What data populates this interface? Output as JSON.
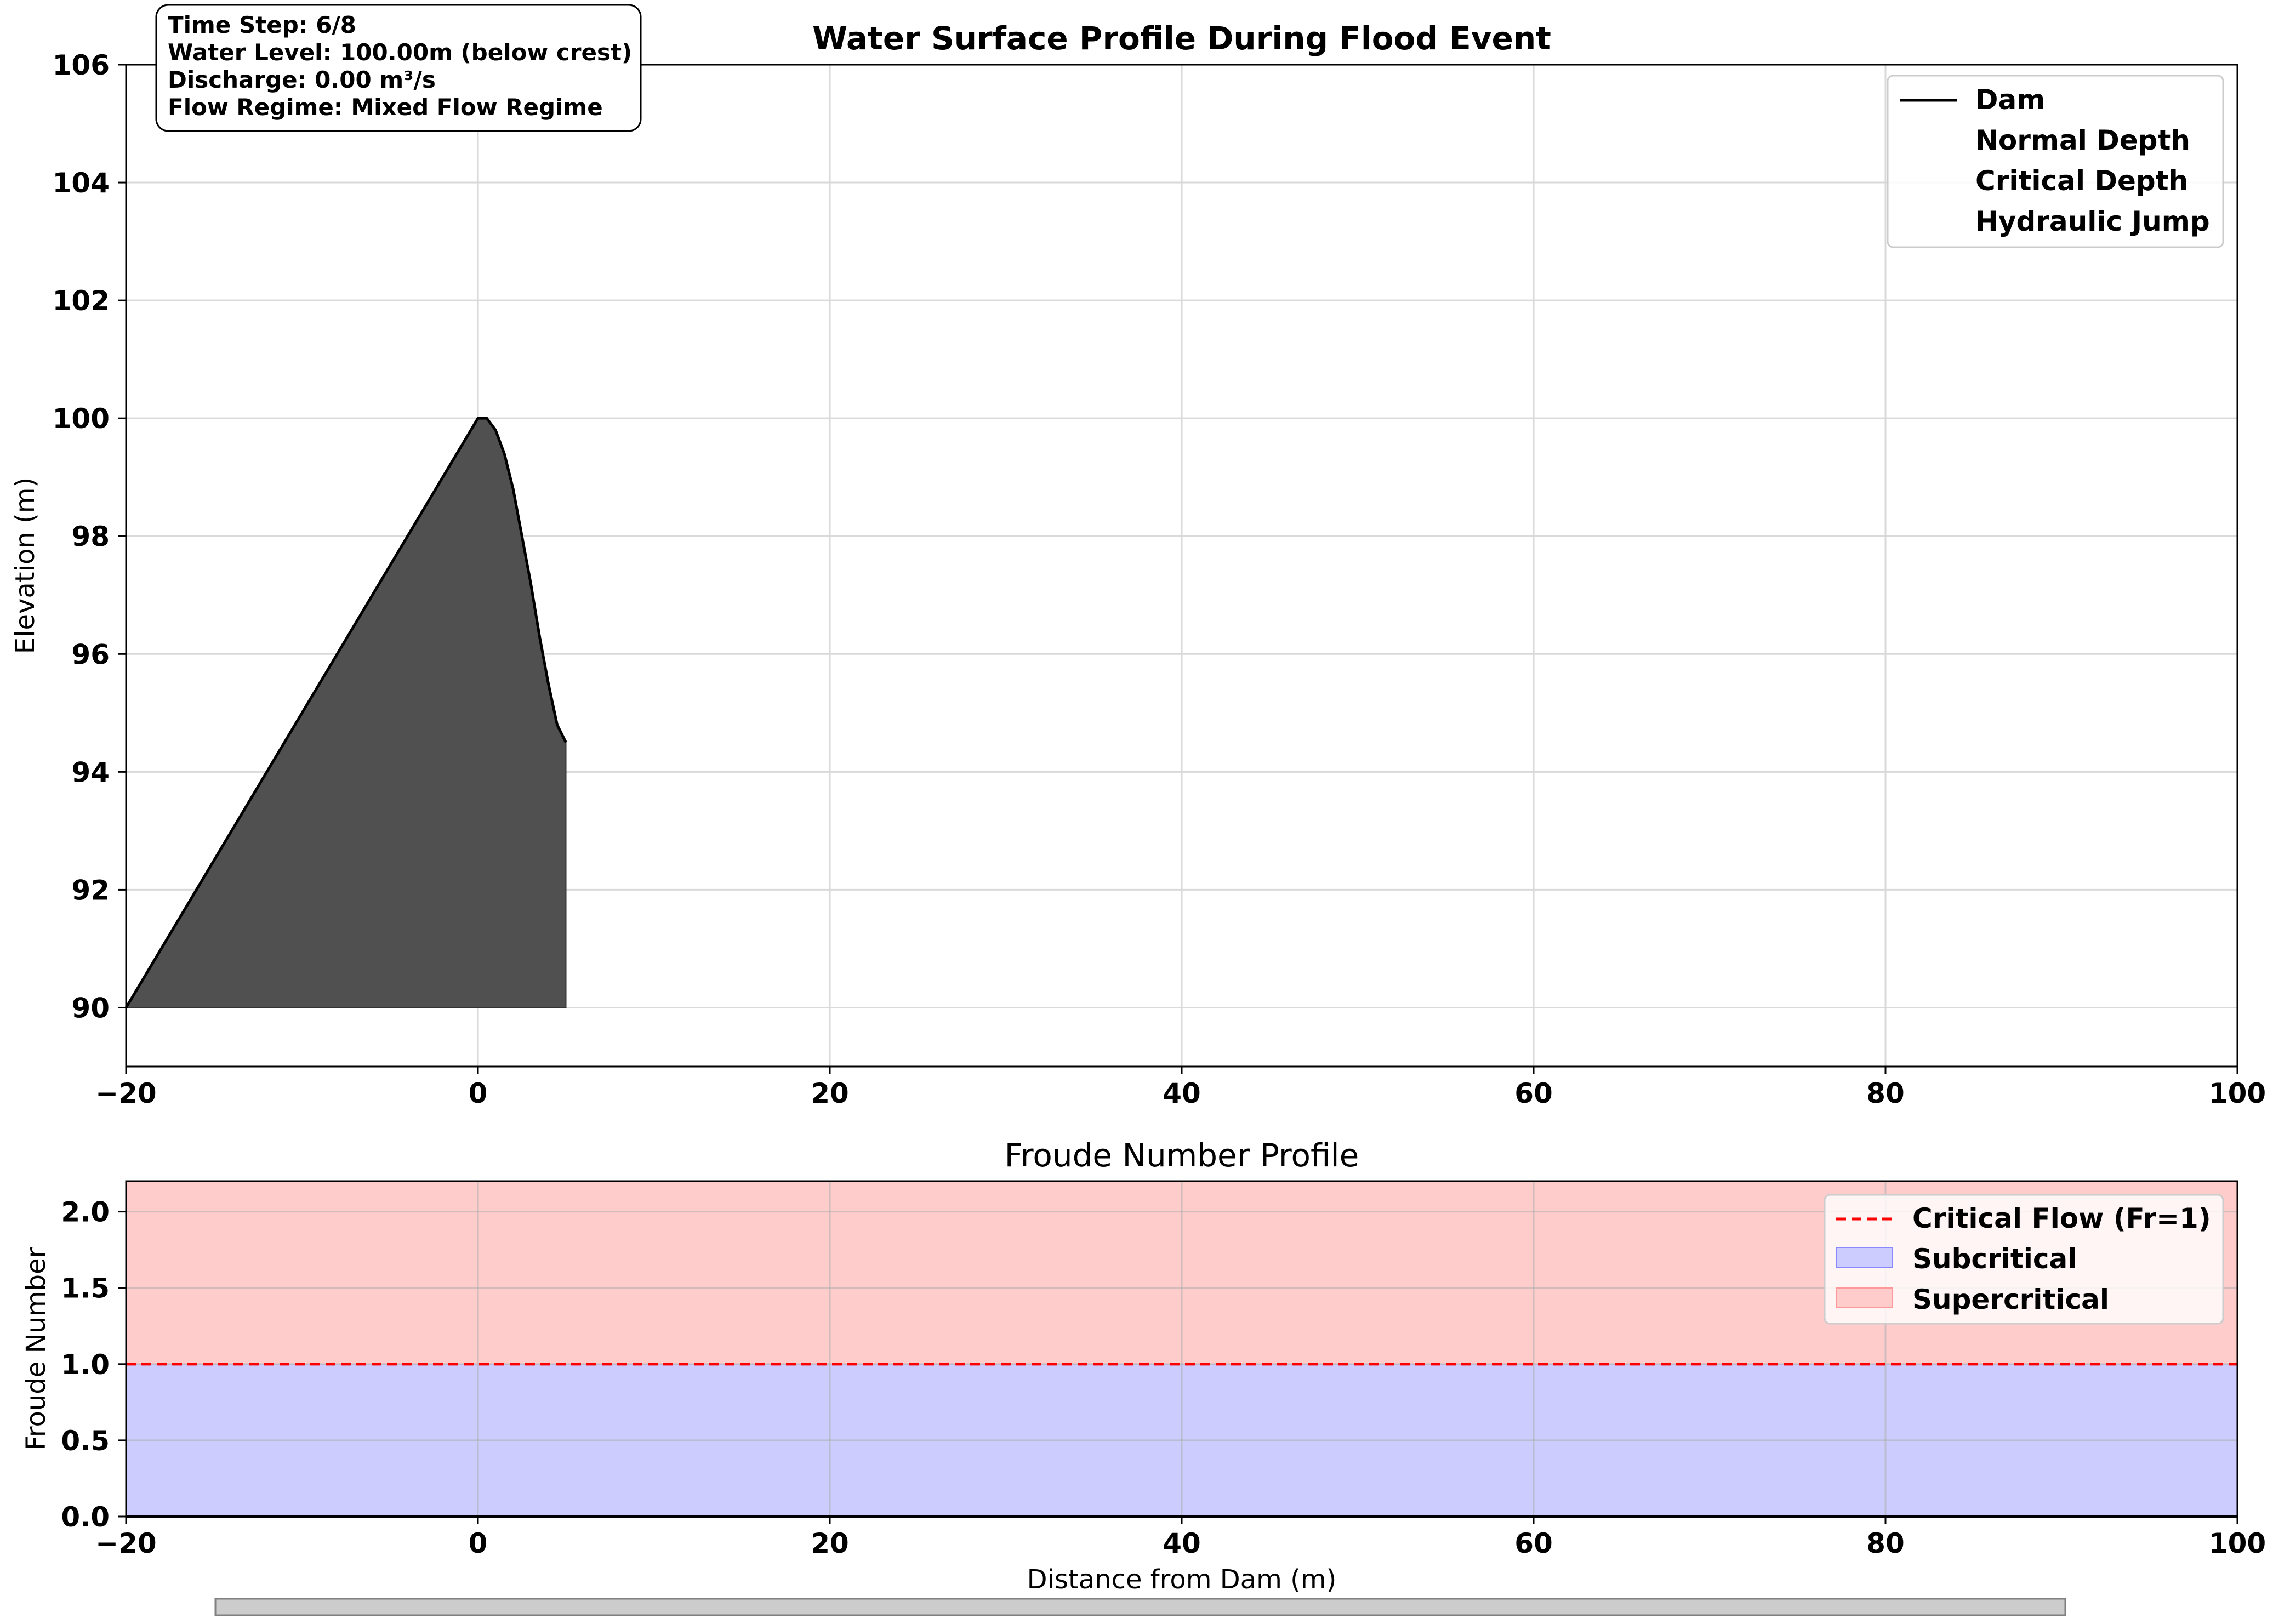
{
  "figure": {
    "info_box": {
      "lines": [
        "Time Step: 6/8",
        "Water Level: 100.00m (below crest)",
        "Discharge: 0.00 m³/s",
        "Flow Regime: Mixed Flow Regime"
      ]
    },
    "slider": {
      "label": ""
    }
  },
  "chart_data": [
    {
      "type": "area",
      "title": "Water Surface Profile During Flood Event",
      "xlabel": "",
      "ylabel": "Elevation (m)",
      "xlim": [
        -20,
        100
      ],
      "ylim": [
        89,
        106
      ],
      "xticks": [
        -20,
        0,
        20,
        40,
        60,
        80,
        100
      ],
      "yticks": [
        90,
        92,
        94,
        96,
        98,
        100,
        102,
        104,
        106
      ],
      "xtick_labels": [
        "−20",
        "0",
        "20",
        "40",
        "60",
        "80",
        "100"
      ],
      "ytick_labels": [
        "90",
        "92",
        "94",
        "96",
        "98",
        "100",
        "102",
        "104",
        "106"
      ],
      "grid": true,
      "legend_position": "top-right",
      "legend": [
        {
          "label": "Dam",
          "style": "line",
          "color": "#000000"
        },
        {
          "label": "Normal Depth",
          "style": "none"
        },
        {
          "label": "Critical Depth",
          "style": "none"
        },
        {
          "label": "Hydraulic Jump",
          "style": "none"
        }
      ],
      "series": [
        {
          "name": "Dam",
          "color": "#000000",
          "fill": "#505050",
          "base": 90,
          "x": [
            -20,
            0,
            0.5,
            1.0,
            1.5,
            2.0,
            2.5,
            3.0,
            3.5,
            4.0,
            4.5,
            5.0
          ],
          "y": [
            90,
            100,
            100,
            99.8,
            99.4,
            98.8,
            98.0,
            97.2,
            96.3,
            95.5,
            94.8,
            94.5
          ]
        }
      ]
    },
    {
      "type": "area",
      "title": "Froude Number Profile",
      "xlabel": "Distance from Dam (m)",
      "ylabel": "Froude Number",
      "xlim": [
        -20,
        100
      ],
      "ylim": [
        0,
        2.2
      ],
      "xticks": [
        -20,
        0,
        20,
        40,
        60,
        80,
        100
      ],
      "yticks": [
        0,
        0.5,
        1.0,
        1.5,
        2.0
      ],
      "xtick_labels": [
        "−20",
        "0",
        "20",
        "40",
        "60",
        "80",
        "100"
      ],
      "ytick_labels": [
        "0.0",
        "0.5",
        "1.0",
        "1.5",
        "2.0"
      ],
      "grid": true,
      "legend_position": "top-right",
      "legend": [
        {
          "label": "Critical Flow (Fr=1)",
          "style": "dashed",
          "color": "#ff0000"
        },
        {
          "label": "Subcritical",
          "style": "patch",
          "color": "#ccccff"
        },
        {
          "label": "Supercritical",
          "style": "patch",
          "color": "#ffcccc"
        }
      ],
      "bands": [
        {
          "name": "Subcritical",
          "from": 0,
          "to": 1,
          "color": "#ccccff"
        },
        {
          "name": "Supercritical",
          "from": 1,
          "to": 2.2,
          "color": "#ffcccc"
        }
      ],
      "critical_line": {
        "y": 1,
        "color": "#ff0000"
      },
      "series": [
        {
          "name": "",
          "color": "#000000",
          "x": [
            -20,
            100
          ],
          "y": [
            0,
            0
          ]
        }
      ]
    }
  ]
}
